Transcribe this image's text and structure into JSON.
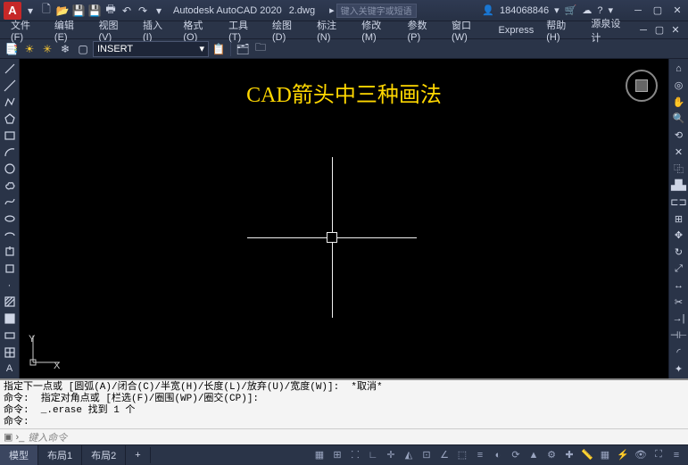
{
  "title": {
    "app": "Autodesk AutoCAD 2020",
    "file": "2.dwg"
  },
  "search": {
    "placeholder": "键入关键字或短语"
  },
  "user": {
    "id": "184068846"
  },
  "menus": [
    "文件(F)",
    "编辑(E)",
    "视图(V)",
    "插入(I)",
    "格式(O)",
    "工具(T)",
    "绘图(D)",
    "标注(N)",
    "修改(M)",
    "参数(P)",
    "窗口(W)",
    "Express",
    "帮助(H)",
    "源泉设计"
  ],
  "layer": {
    "current": "INSERT"
  },
  "canvas": {
    "heading": "CAD箭头中三种画法",
    "ucs_x": "X",
    "ucs_y": "Y"
  },
  "cmd": {
    "l1": "指定下一点或 [圆弧(A)/闭合(C)/半宽(H)/长度(L)/放弃(U)/宽度(W)]:  *取消*",
    "l2": "命令:  指定对角点或 [栏选(F)/圈围(WP)/圈交(CP)]:",
    "l3": "命令:  _.erase 找到 1 个",
    "l4": "命令:",
    "prompt": "键入命令"
  },
  "tabs": {
    "model": "模型",
    "layout1": "布局1",
    "layout2": "布局2",
    "plus": "+"
  }
}
